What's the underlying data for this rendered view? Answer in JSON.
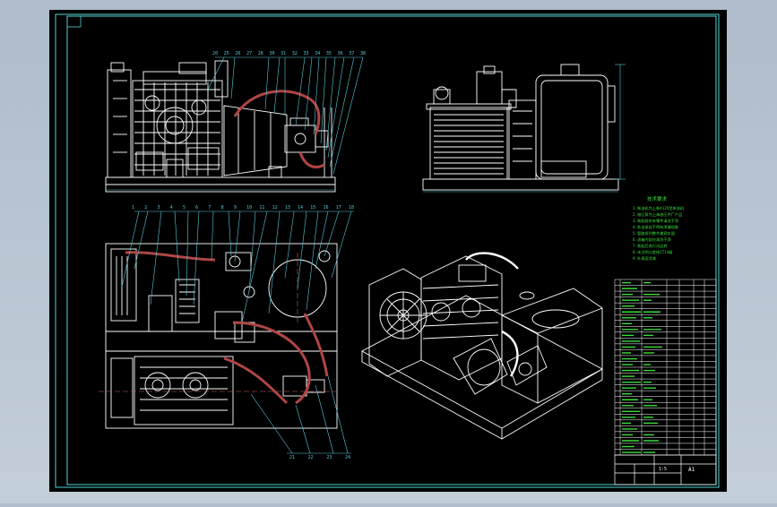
{
  "colors": {
    "frame_bg": "#000000",
    "chrome": "#b4c2d0",
    "border": "#4fd3d3",
    "line": "#ffffff",
    "hose": "#b04545",
    "notes": "#3cdc3c",
    "leader": "#58c8d8",
    "dim_text": "#d07070"
  },
  "top_front_callouts": [
    "20",
    "25",
    "26",
    "27",
    "28",
    "30",
    "31",
    "32",
    "33",
    "34",
    "35",
    "36",
    "37",
    "38"
  ],
  "plan_callouts_top": [
    "1",
    "2",
    "3",
    "4",
    "5",
    "6",
    "7",
    "8",
    "9",
    "10",
    "11",
    "12",
    "13",
    "14",
    "15",
    "16",
    "17",
    "18"
  ],
  "plan_callouts_bottom": [
    "21",
    "22",
    "23",
    "24"
  ],
  "tech_notes": {
    "title": "技术要求",
    "lines": [
      "1.柴油机为上柴4135型柴油机",
      "2.液压泵为上海液压件厂产品",
      "3.装配前所有零件清洗干净",
      "4.各连接处不得有渗漏现象",
      "5.管路排列整齐美观牢固",
      "6.油箱内部应清洗干净",
      "7.装配后进行试运转",
      "8.未注明公差按IT14级",
      "9.外表面涂漆"
    ]
  },
  "title_block": {
    "drawing_no": "A1",
    "scale": "1:5"
  }
}
